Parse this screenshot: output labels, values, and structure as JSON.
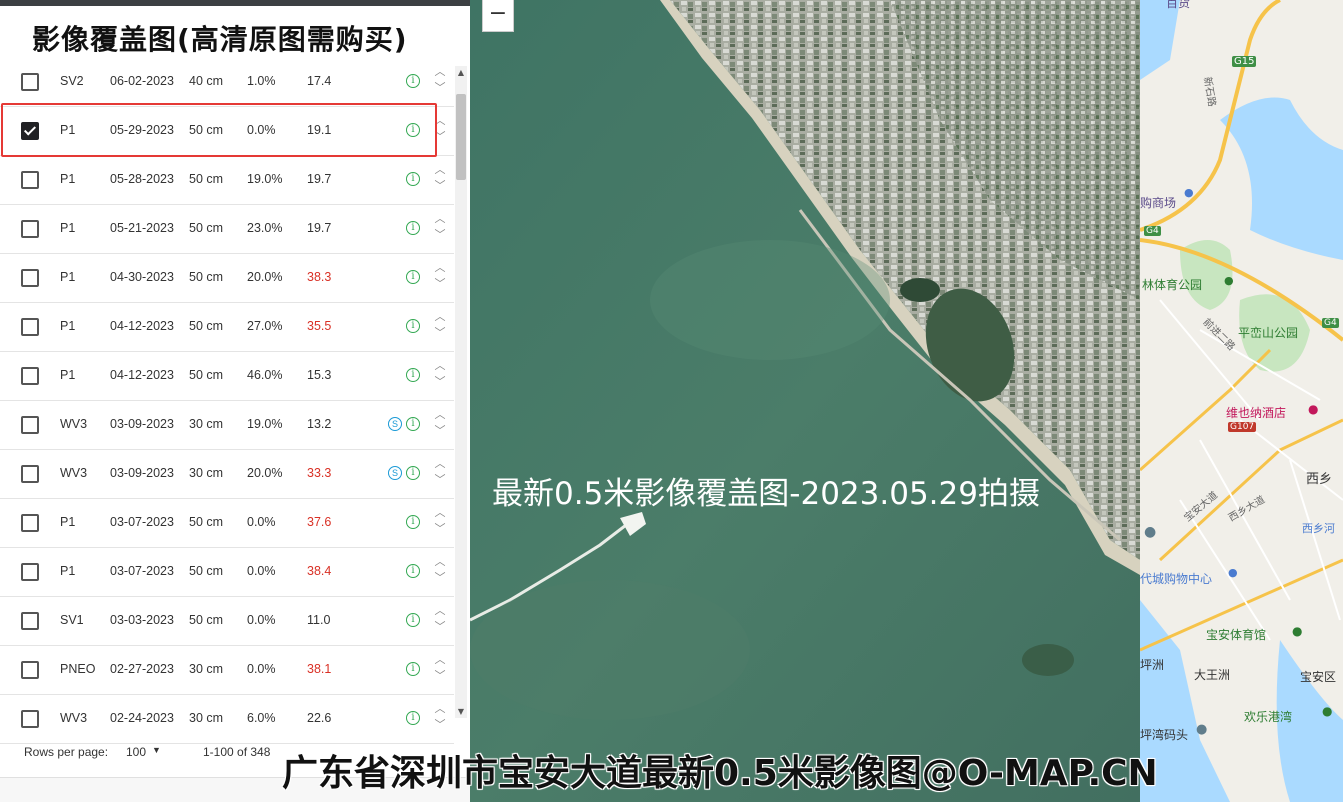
{
  "panel": {
    "title": "影像覆盖图(高清原图需购买)",
    "rows": [
      {
        "satellite": "SV2",
        "date": "06-02-2023",
        "resolution": "40 cm",
        "cloud": "1.0%",
        "angle": "17.4",
        "angle_warning": false,
        "checked": false,
        "stereo": false
      },
      {
        "satellite": "P1",
        "date": "05-29-2023",
        "resolution": "50 cm",
        "cloud": "0.0%",
        "angle": "19.1",
        "angle_warning": false,
        "checked": true,
        "stereo": false
      },
      {
        "satellite": "P1",
        "date": "05-28-2023",
        "resolution": "50 cm",
        "cloud": "19.0%",
        "angle": "19.7",
        "angle_warning": false,
        "checked": false,
        "stereo": false
      },
      {
        "satellite": "P1",
        "date": "05-21-2023",
        "resolution": "50 cm",
        "cloud": "23.0%",
        "angle": "19.7",
        "angle_warning": false,
        "checked": false,
        "stereo": false
      },
      {
        "satellite": "P1",
        "date": "04-30-2023",
        "resolution": "50 cm",
        "cloud": "20.0%",
        "angle": "38.3",
        "angle_warning": true,
        "checked": false,
        "stereo": false
      },
      {
        "satellite": "P1",
        "date": "04-12-2023",
        "resolution": "50 cm",
        "cloud": "27.0%",
        "angle": "35.5",
        "angle_warning": true,
        "checked": false,
        "stereo": false
      },
      {
        "satellite": "P1",
        "date": "04-12-2023",
        "resolution": "50 cm",
        "cloud": "46.0%",
        "angle": "15.3",
        "angle_warning": false,
        "checked": false,
        "stereo": false
      },
      {
        "satellite": "WV3",
        "date": "03-09-2023",
        "resolution": "30 cm",
        "cloud": "19.0%",
        "angle": "13.2",
        "angle_warning": false,
        "checked": false,
        "stereo": true
      },
      {
        "satellite": "WV3",
        "date": "03-09-2023",
        "resolution": "30 cm",
        "cloud": "20.0%",
        "angle": "33.3",
        "angle_warning": true,
        "checked": false,
        "stereo": true
      },
      {
        "satellite": "P1",
        "date": "03-07-2023",
        "resolution": "50 cm",
        "cloud": "0.0%",
        "angle": "37.6",
        "angle_warning": true,
        "checked": false,
        "stereo": false
      },
      {
        "satellite": "P1",
        "date": "03-07-2023",
        "resolution": "50 cm",
        "cloud": "0.0%",
        "angle": "38.4",
        "angle_warning": true,
        "checked": false,
        "stereo": false
      },
      {
        "satellite": "SV1",
        "date": "03-03-2023",
        "resolution": "50 cm",
        "cloud": "0.0%",
        "angle": "11.0",
        "angle_warning": false,
        "checked": false,
        "stereo": false
      },
      {
        "satellite": "PNEO",
        "date": "02-27-2023",
        "resolution": "30 cm",
        "cloud": "0.0%",
        "angle": "38.1",
        "angle_warning": true,
        "checked": false,
        "stereo": false
      },
      {
        "satellite": "WV3",
        "date": "02-24-2023",
        "resolution": "30 cm",
        "cloud": "6.0%",
        "angle": "22.6",
        "angle_warning": false,
        "checked": false,
        "stereo": false
      }
    ],
    "footer": {
      "rows_per_page_label": "Rows per page:",
      "rows_per_page_value": "100",
      "range": "1-100 of 348"
    }
  },
  "icons": {
    "info": "info-circle-icon",
    "stereo": "stereo-s-icon",
    "sort_up": "chevron-up-icon",
    "sort_down": "chevron-down-icon",
    "dropdown": "caret-down-icon"
  },
  "map": {
    "zoom_out_label": "−",
    "caption": "最新0.5米影像覆盖图-2023.05.29拍摄"
  },
  "basemap": {
    "road_shields": [
      "G15",
      "G4",
      "G4",
      "G107"
    ],
    "labels": [
      "百货",
      "新石路",
      "购商场",
      "林体育公园",
      "平峦山公园",
      "前进二路",
      "维也纳酒店",
      "西乡",
      "宝安大道",
      "西乡大道",
      "西乡河",
      "代城购物中心",
      "宝安体育馆",
      "坪洲",
      "大王洲",
      "宝安区",
      "欢乐港湾",
      "坪湾码头"
    ]
  },
  "colors": {
    "highlight": "#e53935",
    "warning_text": "#d93025",
    "info_green": "#34a853",
    "stereo_blue": "#1a9ad6",
    "sea": "#4a7a68",
    "map_water": "#aadaff",
    "map_park": "#c8e6c0",
    "map_highway": "#f6c34a"
  },
  "watermark": "广东省深圳市宝安大道最新0.5米影像图@O-MAP.CN"
}
